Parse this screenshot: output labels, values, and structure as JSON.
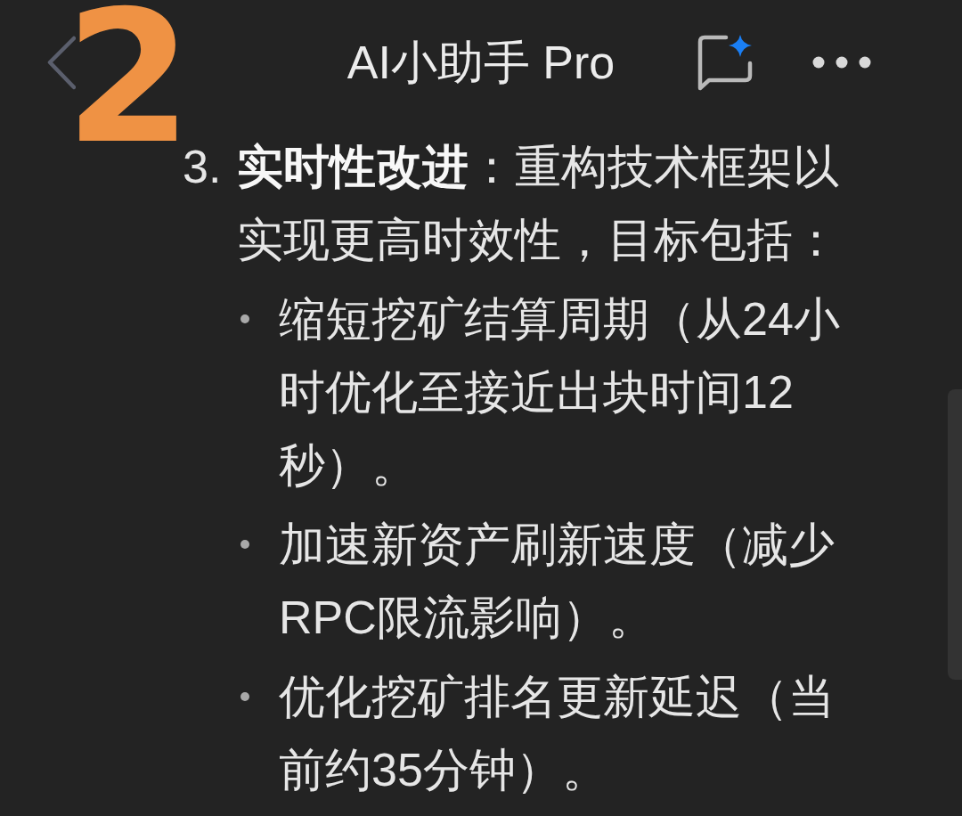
{
  "annotation": "2",
  "header": {
    "title": "AI小助手 Pro"
  },
  "list_item": {
    "number": "3.",
    "text": "**实时性改进**：重构技术框架以实现更高时效性，目标包括：",
    "children": [
      {
        "text": "缩短挖矿结算周期（从24小时优化至接近出块时间12秒）。"
      },
      {
        "text": "加速新资产刷新速度（减少RPC限流影响）。"
      },
      {
        "text": "优化挖矿排名更新延迟（当前约35分钟）。"
      }
    ]
  }
}
